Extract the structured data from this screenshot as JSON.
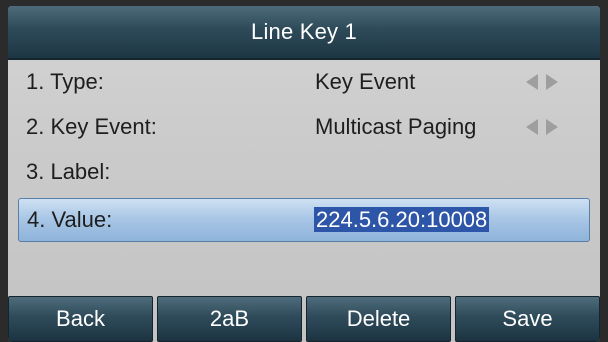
{
  "header": {
    "title": "Line Key 1"
  },
  "fields": [
    {
      "label": "1. Type:",
      "value": "Key Event",
      "has_arrows": true
    },
    {
      "label": "2. Key Event:",
      "value": "Multicast Paging",
      "has_arrows": true
    },
    {
      "label": "3. Label:",
      "value": "",
      "has_arrows": false
    },
    {
      "label": "4. Value:",
      "value": "224.5.6.20:10008",
      "selected": true
    }
  ],
  "softkeys": [
    "Back",
    "2aB",
    "Delete",
    "Save"
  ],
  "colors": {
    "title_bar": "#2e4a58",
    "selected_row": "#a9c7e6",
    "value_highlight": "#2d55a8",
    "arrow": "#9e9e9e"
  },
  "icons": {
    "prev": "triangle-left-icon",
    "next": "triangle-right-icon"
  }
}
